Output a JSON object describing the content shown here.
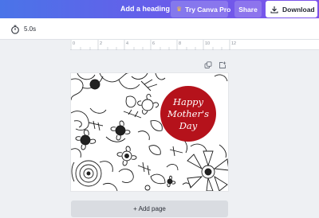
{
  "topbar": {
    "add_heading": "Add a heading",
    "try_canva_pro": "Try Canva Pro",
    "share": "Share",
    "download": "Download"
  },
  "toolbar": {
    "duration": "5.0s"
  },
  "ruler": {
    "ticks": [
      "0",
      "2",
      "4",
      "6",
      "8",
      "10",
      "12"
    ]
  },
  "design": {
    "greeting_lines": [
      "Happy",
      "Mother's",
      "Day"
    ]
  },
  "add_page_label": "+ Add page",
  "colors": {
    "topbar_start": "#4a74e8",
    "topbar_end": "#7d52ea",
    "badge": "#b5121b",
    "crown": "#f7c13a"
  },
  "icons": {
    "timer": "stopwatch-icon",
    "download": "download-icon",
    "crown": "crown-icon",
    "duplicate_page": "duplicate-icon",
    "add_page_icon": "add-page-icon"
  }
}
